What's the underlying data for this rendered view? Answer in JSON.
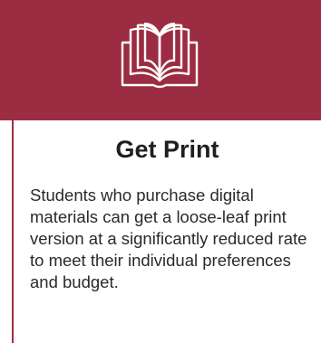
{
  "feature": {
    "icon": "open-book-icon",
    "title": "Get Print",
    "description": "Students who purchase digital materials can get a loose-leaf print version at a significantly reduced rate to meet their individual preferences and budget."
  },
  "colors": {
    "accent": "#9b2c41",
    "icon_stroke": "#ffffff",
    "title_text": "#1f1f1f",
    "body_text": "#2a2a2a",
    "background": "#ffffff"
  }
}
